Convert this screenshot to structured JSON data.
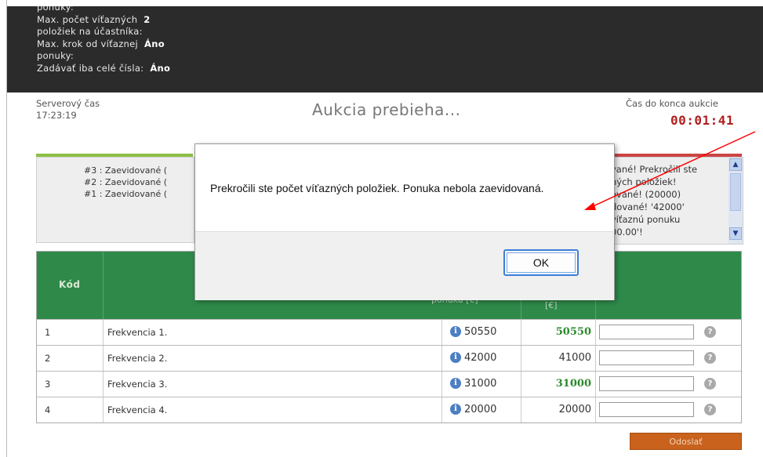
{
  "auction_info": {
    "lines": [
      {
        "label": "ponuky:",
        "value": ""
      },
      {
        "label": "Max. počet víťazných",
        "value": "2"
      },
      {
        "label": "položiek na účastníka:",
        "value": ""
      },
      {
        "label": "Max. krok od víťaznej",
        "value": "Áno"
      },
      {
        "label": "ponuky:",
        "value": ""
      },
      {
        "label": "Zadávať iba celé čísla:",
        "value": "Áno"
      }
    ]
  },
  "header": {
    "server_time_label": "Serverový čas",
    "server_time": "17:23:19",
    "status_title": "Aukcia prebieha...",
    "countdown_label": "Čas do konca aukcie",
    "countdown": "00:01:41"
  },
  "log_left": {
    "rows": [
      "#3 : Zaevidované (",
      "#2 : Zaevidované (",
      "#1 : Zaevidované ("
    ]
  },
  "log_right": {
    "lines": [
      "vané! Prekročili ste",
      "ných položiek!",
      "ované! (20000)",
      "dované! '42000'",
      "víťaznú ponuku",
      "00.00'!"
    ]
  },
  "table": {
    "header_code": "Kód",
    "header_offer": "ponuka [€]",
    "header_win": "[€]",
    "rows": [
      {
        "code": "1",
        "name": "Frekvencia 1.",
        "offer": "50550",
        "win": "50550",
        "win_green": true
      },
      {
        "code": "2",
        "name": "Frekvencia 2.",
        "offer": "42000",
        "win": "41000",
        "win_green": false
      },
      {
        "code": "3",
        "name": "Frekvencia 3.",
        "offer": "31000",
        "win": "31000",
        "win_green": true
      },
      {
        "code": "4",
        "name": "Frekvencia 4.",
        "offer": "20000",
        "win": "20000",
        "win_green": false
      }
    ]
  },
  "submit_label": "Odoslať",
  "dialog": {
    "message": "Prekročili ste počet víťazných položiek. Ponuka nebola zaevidovaná.",
    "ok_label": "OK"
  },
  "colors": {
    "header_bg": "#2b2b2b",
    "table_header": "#2f8a4a",
    "countdown": "#b02020",
    "submit": "#c9621c",
    "arrow": "#ff0000"
  }
}
